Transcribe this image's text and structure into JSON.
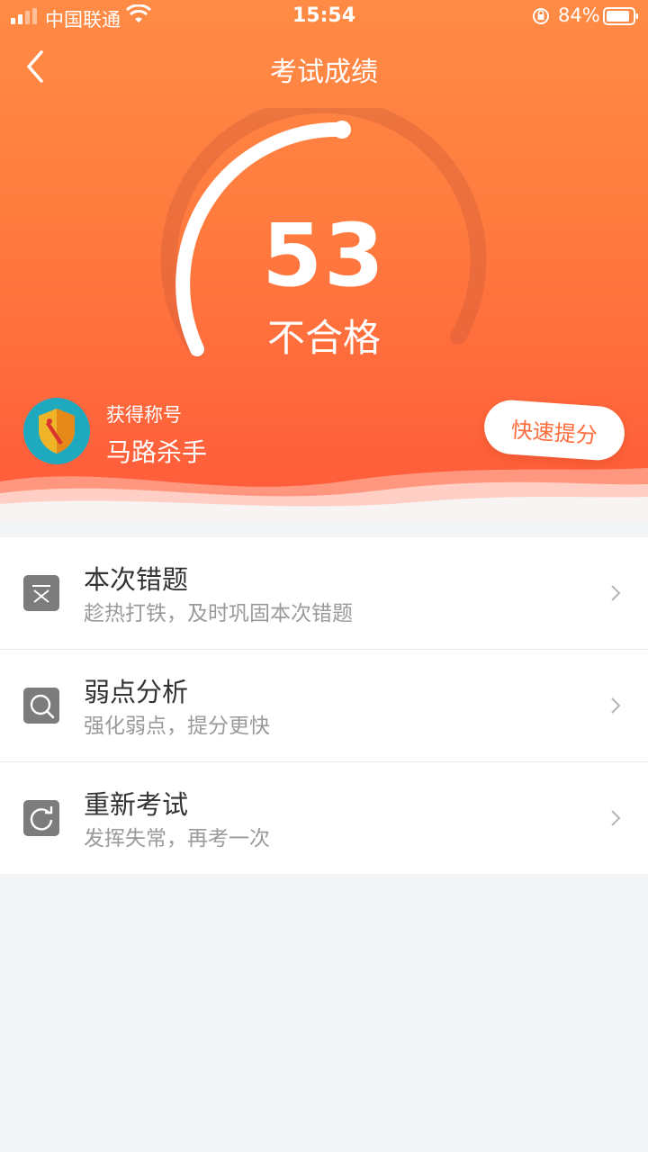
{
  "status": {
    "carrier": "中国联通",
    "time": "15:54",
    "battery": "84%"
  },
  "nav": {
    "title": "考试成绩"
  },
  "score": {
    "value": "53",
    "result": "不合格",
    "max": 100
  },
  "honor": {
    "label": "获得称号",
    "name": "马路杀手"
  },
  "quick_button": "快速提分",
  "menu": [
    {
      "title": "本次错题",
      "subtitle": "趁热打铁，及时巩固本次错题",
      "icon": "wrong-questions-icon"
    },
    {
      "title": "弱点分析",
      "subtitle": "强化弱点，提分更快",
      "icon": "magnifier-icon"
    },
    {
      "title": "重新考试",
      "subtitle": "发挥失常，再考一次",
      "icon": "retry-icon"
    }
  ],
  "colors": {
    "accent": "#ff6d3c",
    "gradient_top": "#ff8b45",
    "gradient_bottom": "#ff5a3a"
  }
}
